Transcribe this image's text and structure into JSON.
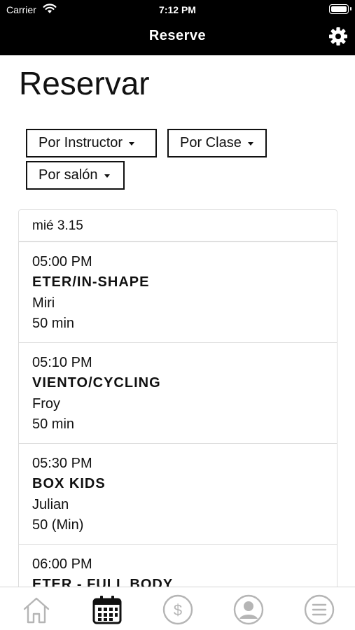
{
  "status_bar": {
    "carrier": "Carrier",
    "time": "7:12 PM"
  },
  "nav": {
    "title": "Reserve",
    "settings_icon": "gear-icon"
  },
  "page": {
    "title": "Reservar"
  },
  "filters": [
    {
      "label": "Por Instructor"
    },
    {
      "label": "Por Clase"
    },
    {
      "label": "Por salón"
    }
  ],
  "schedule": {
    "day": "mié 3.15",
    "classes": [
      {
        "time": "05:00 PM",
        "name": "ETER/IN-SHAPE",
        "instructor": "Miri",
        "duration": "50 min"
      },
      {
        "time": "05:10 PM",
        "name": "VIENTO/CYCLING",
        "instructor": "Froy",
        "duration": "50 min"
      },
      {
        "time": "05:30 PM",
        "name": "BOX KIDS",
        "instructor": "Julian",
        "duration": "50 (Min)"
      },
      {
        "time": "06:00 PM",
        "name": "ETER - FULL BODY",
        "instructor": "",
        "duration": ""
      }
    ]
  },
  "tabbar": {
    "tabs": [
      {
        "icon": "home-icon",
        "active": false
      },
      {
        "icon": "calendar-icon",
        "active": true
      },
      {
        "icon": "dollar-icon",
        "active": false
      },
      {
        "icon": "profile-icon",
        "active": false
      },
      {
        "icon": "menu-icon",
        "active": false
      }
    ],
    "active_color": "#111111",
    "inactive_color": "#b5b5b5"
  }
}
